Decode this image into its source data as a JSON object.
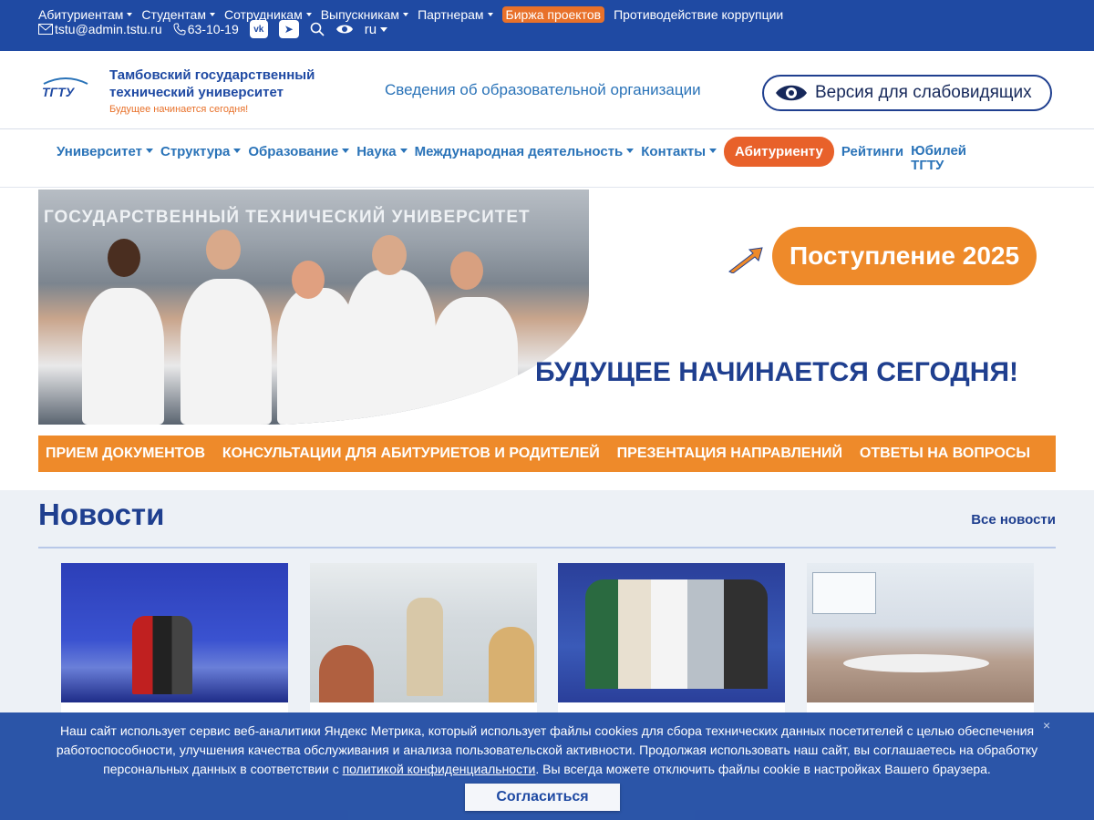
{
  "topbar": {
    "menu": [
      "Абитуриентам",
      "Студентам",
      "Сотрудникам",
      "Выпускникам",
      "Партнерам"
    ],
    "badge": "Биржа проектов",
    "anticorruption": "Противодействие коррупции",
    "email": "tstu@admin.tstu.ru",
    "phone": "63-10-19",
    "lang": "ru",
    "vk_icon": "vk-icon",
    "tg_icon": "telegram-icon"
  },
  "header": {
    "logo_text": "ТГТУ",
    "name_line1": "Тамбовский государственный",
    "name_line2": "технический университет",
    "slogan": "Будущее  начинается сегодня!",
    "org_info": "Сведения об образовательной организации",
    "low_vision": "Версия для слабовидящих"
  },
  "mainnav": {
    "items": [
      "Университет",
      "Структура",
      "Образование",
      "Наука",
      "Международная деятельность",
      "Контакты"
    ],
    "cta": "Абитуриенту",
    "ratings": "Рейтинги",
    "jubilee": "Юбилей ТГТУ"
  },
  "banner": {
    "sign": "ГОСУДАРСТВЕННЫЙ ТЕХНИЧЕСКИЙ УНИВЕРСИТЕТ",
    "admission": "Поступление 2025",
    "future": "БУДУЩЕЕ НАЧИНАЕТСЯ СЕГОДНЯ!"
  },
  "orangebar": [
    "ПРИЕМ ДОКУМЕНТОВ",
    "КОНСУЛЬТАЦИИ ДЛЯ АБИТУРИЕТОВ И РОДИТЕЛЕЙ",
    "ПРЕЗЕНТАЦИЯ НАПРАВЛЕНИЙ",
    "ОТВЕТЫ НА ВОПРОСЫ"
  ],
  "news": {
    "title": "Новости",
    "all": "Все новости"
  },
  "cookie": {
    "text_before": "Наш сайт использует сервис веб-аналитики Яндекс Метрика, который использует файлы cookies для сбора технических данных посетителей с целью обеспечения работоспособности, улучшения качества обслуживания и анализа пользовательской активности. Продолжая использовать наш сайт, вы соглашаетесь на обработку персональных данных в соответствии с ",
    "link": "политикой конфиденциальности",
    "text_after": ". Вы всегда можете отключить файлы cookie в настройках Вашего браузера.",
    "button": "Согласиться",
    "close": "×"
  },
  "colors": {
    "brand_blue": "#1f4aa3",
    "accent_orange": "#ee8a2a"
  }
}
